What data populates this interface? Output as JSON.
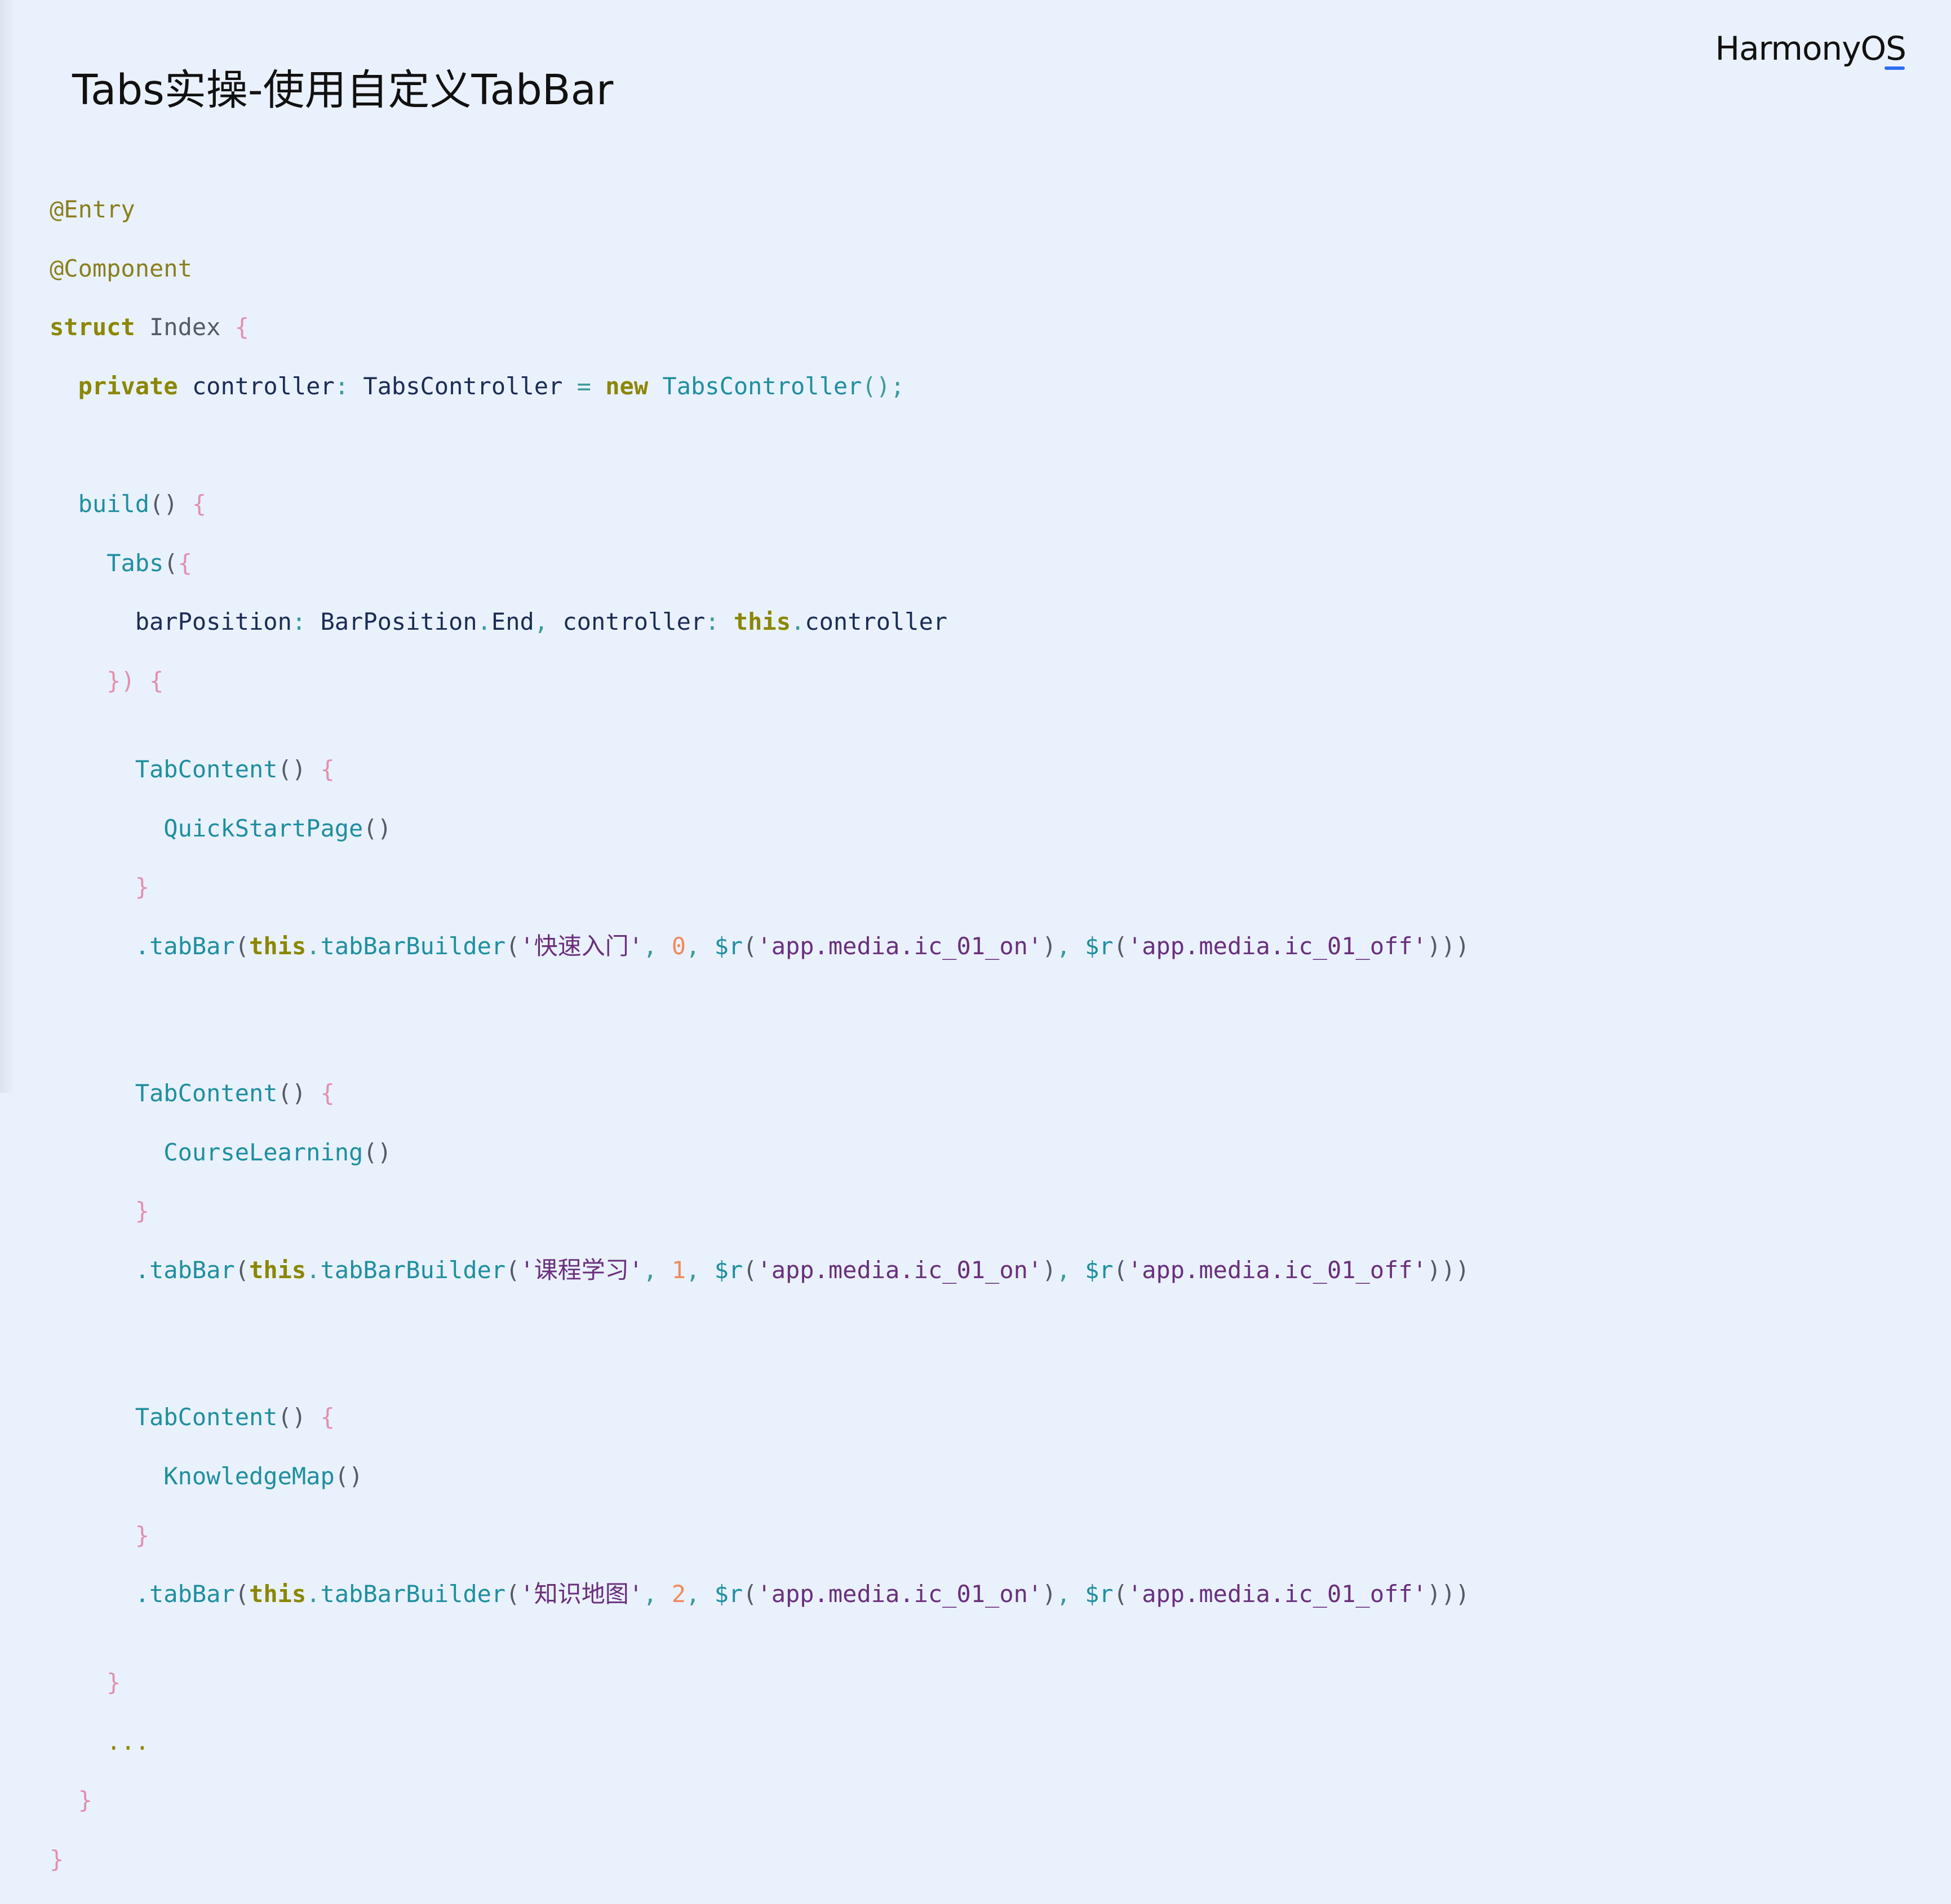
{
  "slide": {
    "title": "Tabs实操-使用自定义TabBar",
    "logo": "HarmonyOS"
  },
  "code": {
    "l1_ann": "@Entry",
    "l2_ann": "@Component",
    "l3_kw": "struct",
    "l3_name": "Index",
    "l4_kw": "private",
    "l4_field": "controller",
    "l4_type": "TabsController",
    "l4_new": "new",
    "l4_ctor": "TabsController",
    "l6_fn": "build",
    "l7_fn": "Tabs",
    "l8_p1": "barPosition",
    "l8_v1": "BarPosition",
    "l8_v1b": "End",
    "l8_p2": "controller",
    "l8_this": "this",
    "l8_v2": "controller",
    "tabs": [
      {
        "content_fn": "TabContent",
        "page_fn": "QuickStartPage",
        "tabbar_fn": "tabBar",
        "this": "this",
        "builder_fn": "tabBarBuilder",
        "label": "'快速入门'",
        "index": "0",
        "r1": "$r",
        "on_res": "'app.media.ic_01_on'",
        "r2": "$r",
        "off_res": "'app.media.ic_01_off'"
      },
      {
        "content_fn": "TabContent",
        "page_fn": "CourseLearning",
        "tabbar_fn": "tabBar",
        "this": "this",
        "builder_fn": "tabBarBuilder",
        "label": "'课程学习'",
        "index": "1",
        "r1": "$r",
        "on_res": "'app.media.ic_01_on'",
        "r2": "$r",
        "off_res": "'app.media.ic_01_off'"
      },
      {
        "content_fn": "TabContent",
        "page_fn": "KnowledgeMap",
        "tabbar_fn": "tabBar",
        "this": "this",
        "builder_fn": "tabBarBuilder",
        "label": "'知识地图'",
        "index": "2",
        "r1": "$r",
        "on_res": "'app.media.ic_01_on'",
        "r2": "$r",
        "off_res": "'app.media.ic_01_off'"
      }
    ],
    "ellipsis": "..."
  }
}
